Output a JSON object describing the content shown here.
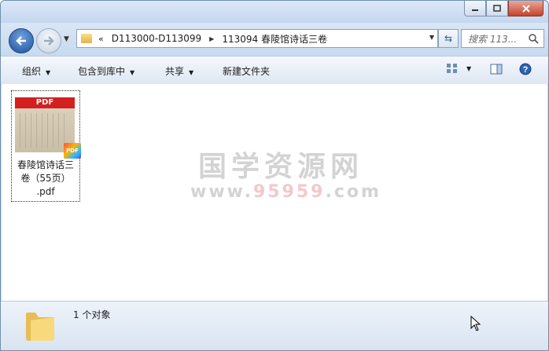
{
  "window": {
    "minimize_icon": "minimize-icon",
    "maximize_icon": "maximize-icon",
    "close_icon": "close-icon"
  },
  "nav": {
    "back_icon": "back-arrow-icon",
    "forward_icon": "forward-arrow-icon",
    "overflow_chevron": "«",
    "breadcrumbs": [
      "D113000-D113099",
      "113094 春陵馆诗话三卷"
    ],
    "search_placeholder": "搜索 113..."
  },
  "toolbar": {
    "organize": "组织",
    "include_in_library": "包含到库中",
    "share": "共享",
    "new_folder": "新建文件夹",
    "view_icon": "view-options-icon",
    "preview_pane_icon": "preview-pane-icon",
    "help_icon": "help-icon"
  },
  "files": [
    {
      "thumb_label": "PDF",
      "badge_label": "PDF",
      "name_line1": "春陵馆诗话三",
      "name_line2": "卷（55页）",
      "name_line3": ".pdf"
    }
  ],
  "watermark": {
    "title": "国学资源网",
    "url_prefix": "www.",
    "url_highlight": "95959",
    "url_suffix": ".com"
  },
  "status": {
    "count_text": "1 个对象"
  },
  "colors": {
    "titlebar": "#c4d7ef",
    "close_button": "#c5422c",
    "content_bg": "#ffffff",
    "watermark": "#d3d3d3"
  }
}
